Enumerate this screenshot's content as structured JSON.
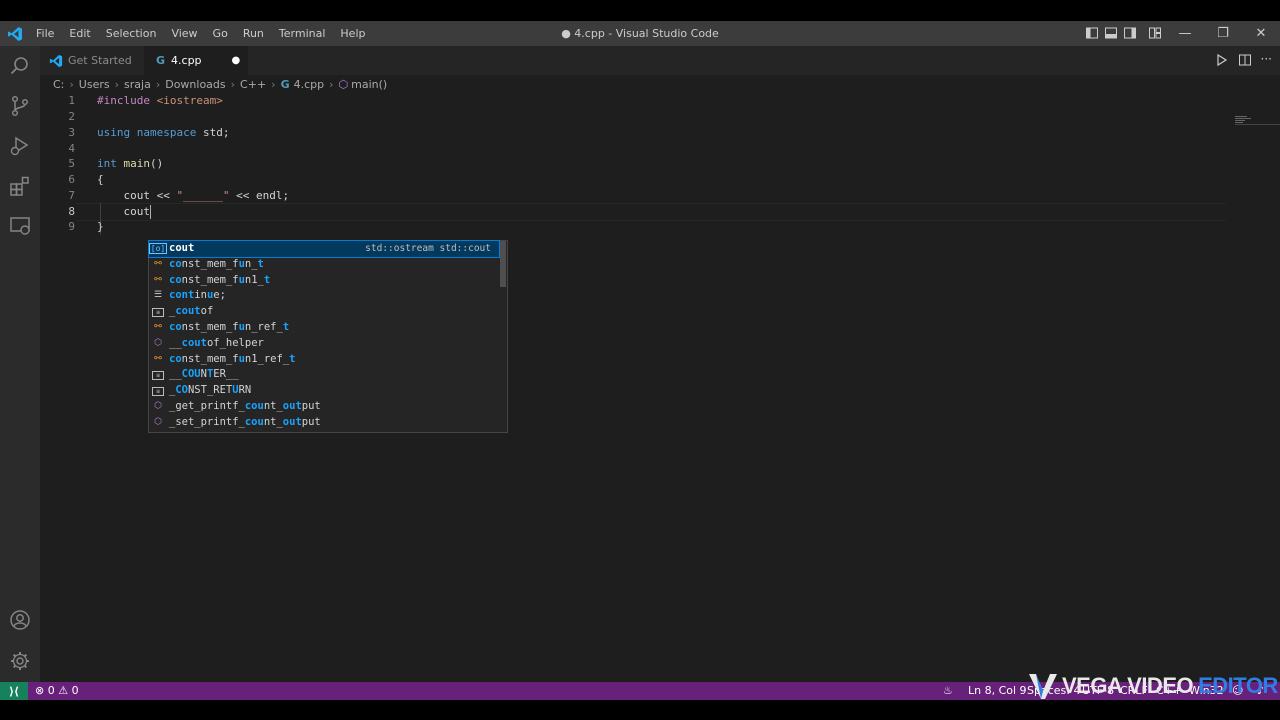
{
  "titlebar": {
    "menu": [
      "File",
      "Edit",
      "Selection",
      "View",
      "Go",
      "Run",
      "Terminal",
      "Help"
    ],
    "title": "● 4.cpp - Visual Studio Code",
    "controls": {
      "minimize": "—",
      "restore": "❐",
      "close": "✕"
    }
  },
  "tabs": [
    {
      "label": "Get Started",
      "icon": "vscode-logo-icon"
    },
    {
      "label": "4.cpp",
      "icon": "cpp-file-icon",
      "modified_dot": "●"
    }
  ],
  "breadcrumb": [
    "C:",
    "Users",
    "sraja",
    "Downloads",
    "C++",
    "4.cpp",
    "main()"
  ],
  "editor": {
    "line_numbers": [
      "1",
      "2",
      "3",
      "4",
      "5",
      "6",
      "7",
      "8",
      "9"
    ],
    "line1": {
      "pp": "#include",
      "inc": " <iostream>"
    },
    "line3": {
      "k1": "using",
      "k2": "namespace",
      "rest": " std;"
    },
    "line5": {
      "ty": "int",
      "fn": "main",
      "rest": "()"
    },
    "line6": "{",
    "line7": {
      "pre": "    cout << ",
      "str": "\"______\"",
      "post": " << endl;"
    },
    "line8": "    cout",
    "line9": "}"
  },
  "suggest": {
    "detail": "std::ostream std::cout",
    "items": [
      {
        "icon": "variable-icon",
        "parts": [
          [
            "cout",
            true
          ]
        ]
      },
      {
        "icon": "class-icon",
        "parts": [
          [
            "co",
            true
          ],
          [
            "nst_mem_f",
            false
          ],
          [
            "u",
            true
          ],
          [
            "n_",
            false
          ],
          [
            "t",
            true
          ]
        ]
      },
      {
        "icon": "class-icon",
        "parts": [
          [
            "co",
            true
          ],
          [
            "nst_mem_f",
            false
          ],
          [
            "u",
            true
          ],
          [
            "n1_",
            false
          ],
          [
            "t",
            true
          ]
        ]
      },
      {
        "icon": "keyword-icon",
        "parts": [
          [
            "cont",
            true
          ],
          [
            "in",
            false
          ],
          [
            "u",
            true
          ],
          [
            "e;",
            false
          ]
        ]
      },
      {
        "icon": "constant-icon",
        "parts": [
          [
            "_",
            false
          ],
          [
            "cout",
            true
          ],
          [
            "of",
            false
          ]
        ]
      },
      {
        "icon": "class-icon",
        "parts": [
          [
            "co",
            true
          ],
          [
            "nst_mem_f",
            false
          ],
          [
            "u",
            true
          ],
          [
            "n_ref_",
            false
          ],
          [
            "t",
            true
          ]
        ]
      },
      {
        "icon": "method-icon",
        "parts": [
          [
            "__",
            false
          ],
          [
            "cout",
            true
          ],
          [
            "of_helper",
            false
          ]
        ]
      },
      {
        "icon": "class-icon",
        "parts": [
          [
            "co",
            true
          ],
          [
            "nst_mem_f",
            false
          ],
          [
            "u",
            true
          ],
          [
            "n1_ref_",
            false
          ],
          [
            "t",
            true
          ]
        ]
      },
      {
        "icon": "constant-icon",
        "parts": [
          [
            "__",
            false
          ],
          [
            "COU",
            true
          ],
          [
            "N",
            false
          ],
          [
            "T",
            true
          ],
          [
            "ER__",
            false
          ]
        ]
      },
      {
        "icon": "constant-icon",
        "parts": [
          [
            "_",
            false
          ],
          [
            "CO",
            true
          ],
          [
            "NST_RET",
            false
          ],
          [
            "U",
            true
          ],
          [
            "RN",
            false
          ]
        ]
      },
      {
        "icon": "method-icon",
        "parts": [
          [
            "_get_printf_",
            false
          ],
          [
            "cou",
            true
          ],
          [
            "nt_",
            false
          ],
          [
            "out",
            true
          ],
          [
            "put",
            false
          ]
        ]
      },
      {
        "icon": "method-icon",
        "parts": [
          [
            "_set_printf_",
            false
          ],
          [
            "cou",
            true
          ],
          [
            "nt_",
            false
          ],
          [
            "out",
            true
          ],
          [
            "put",
            false
          ]
        ]
      }
    ]
  },
  "statusbar": {
    "errors": "0",
    "warnings": "0",
    "position": "Ln 8, Col 9",
    "spaces": "Spaces: 4",
    "encoding": "UTF-8",
    "eol": "CRLF",
    "language": "C++",
    "platform": "Win32"
  },
  "watermark": {
    "a": "VEGA VIDEO",
    "b": "EDITOR"
  },
  "colors": {
    "statusbar": "#68217a",
    "remote": "#16825d",
    "accent": "#007fd4"
  }
}
